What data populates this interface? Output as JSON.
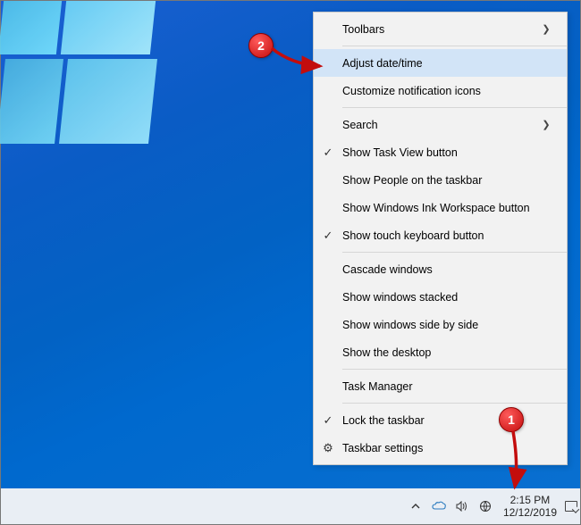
{
  "menu": {
    "groups": [
      [
        {
          "label": "Toolbars",
          "submenu": true
        }
      ],
      [
        {
          "label": "Adjust date/time",
          "highlight": true
        },
        {
          "label": "Customize notification icons"
        }
      ],
      [
        {
          "label": "Search",
          "submenu": true
        },
        {
          "label": "Show Task View button",
          "checked": true
        },
        {
          "label": "Show People on the taskbar"
        },
        {
          "label": "Show Windows Ink Workspace button"
        },
        {
          "label": "Show touch keyboard button",
          "checked": true
        }
      ],
      [
        {
          "label": "Cascade windows"
        },
        {
          "label": "Show windows stacked"
        },
        {
          "label": "Show windows side by side"
        },
        {
          "label": "Show the desktop"
        }
      ],
      [
        {
          "label": "Task Manager"
        }
      ],
      [
        {
          "label": "Lock the taskbar",
          "checked": true
        },
        {
          "label": "Taskbar settings",
          "icon": "gear"
        }
      ]
    ]
  },
  "taskbar": {
    "time": "2:15 PM",
    "date": "12/12/2019"
  },
  "annotations": {
    "badge1": "1",
    "badge2": "2"
  }
}
